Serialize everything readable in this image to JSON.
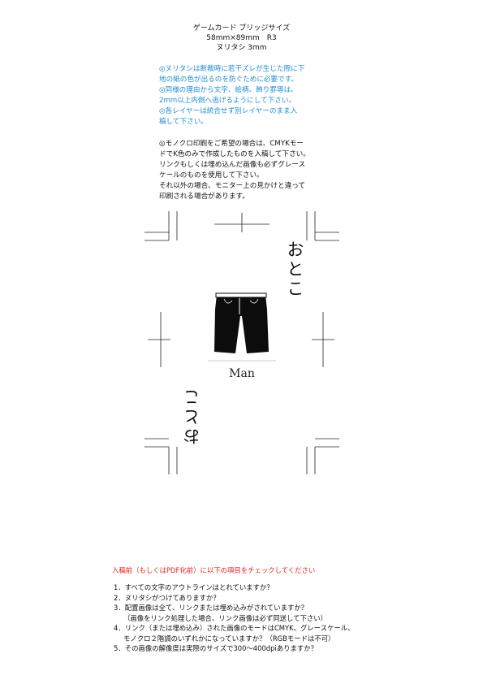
{
  "header": {
    "line1": "ゲームカード ブリッジサイズ",
    "line2": "58mm×89mm　R3",
    "line3": "ヌリタシ 3mm"
  },
  "notes_blue": [
    "◎ヌリタシは断裁時に若干ズレが生じた際に下",
    "地の紙の色が出るのを防ぐために必要です。",
    "◎同様の理由から文字、絵柄、飾り罫等は、",
    "2mm以上内側へ逃げるようにして下さい。",
    "◎各レイヤーは統合せず別レイヤーのまま入",
    "稿して下さい。"
  ],
  "notes_black": [
    "◎モノクロ印刷をご希望の場合は、CMYKモー",
    "ドでK色のみで作成したものを入稿して下さい。",
    "リンクもしくは埋め込んだ画像も必ずグレース",
    "ケールのものを使用して下さい。",
    "それ以外の場合、モニター上の見かけと違って",
    "印刷される場合があります。"
  ],
  "card": {
    "top_text": "おとこ",
    "bottom_text": "おとこ",
    "caption": "Man",
    "illustration": "shorts-icon"
  },
  "checklist": {
    "title": "入稿前（もしくはPDF化前）に以下の項目をチェックしてください",
    "items": [
      "1．すべての文字のアウトラインはとれていますか？",
      "2．ヌリタシがつけてありますか？",
      "3．配置画像は全て、リンクまたは埋め込みがされていますか？",
      "（画像をリンク処理した場合、リンク画像は必ず同送して下さい）",
      "4．リンク（または埋め込み）された画像のモードはCMYK、グレースケール、",
      "モノクロ２階調のいずれかになっていますか？（RGBモードは不可）",
      "5．その画像の解像度は実際のサイズで300〜400dpiありますか？"
    ]
  }
}
